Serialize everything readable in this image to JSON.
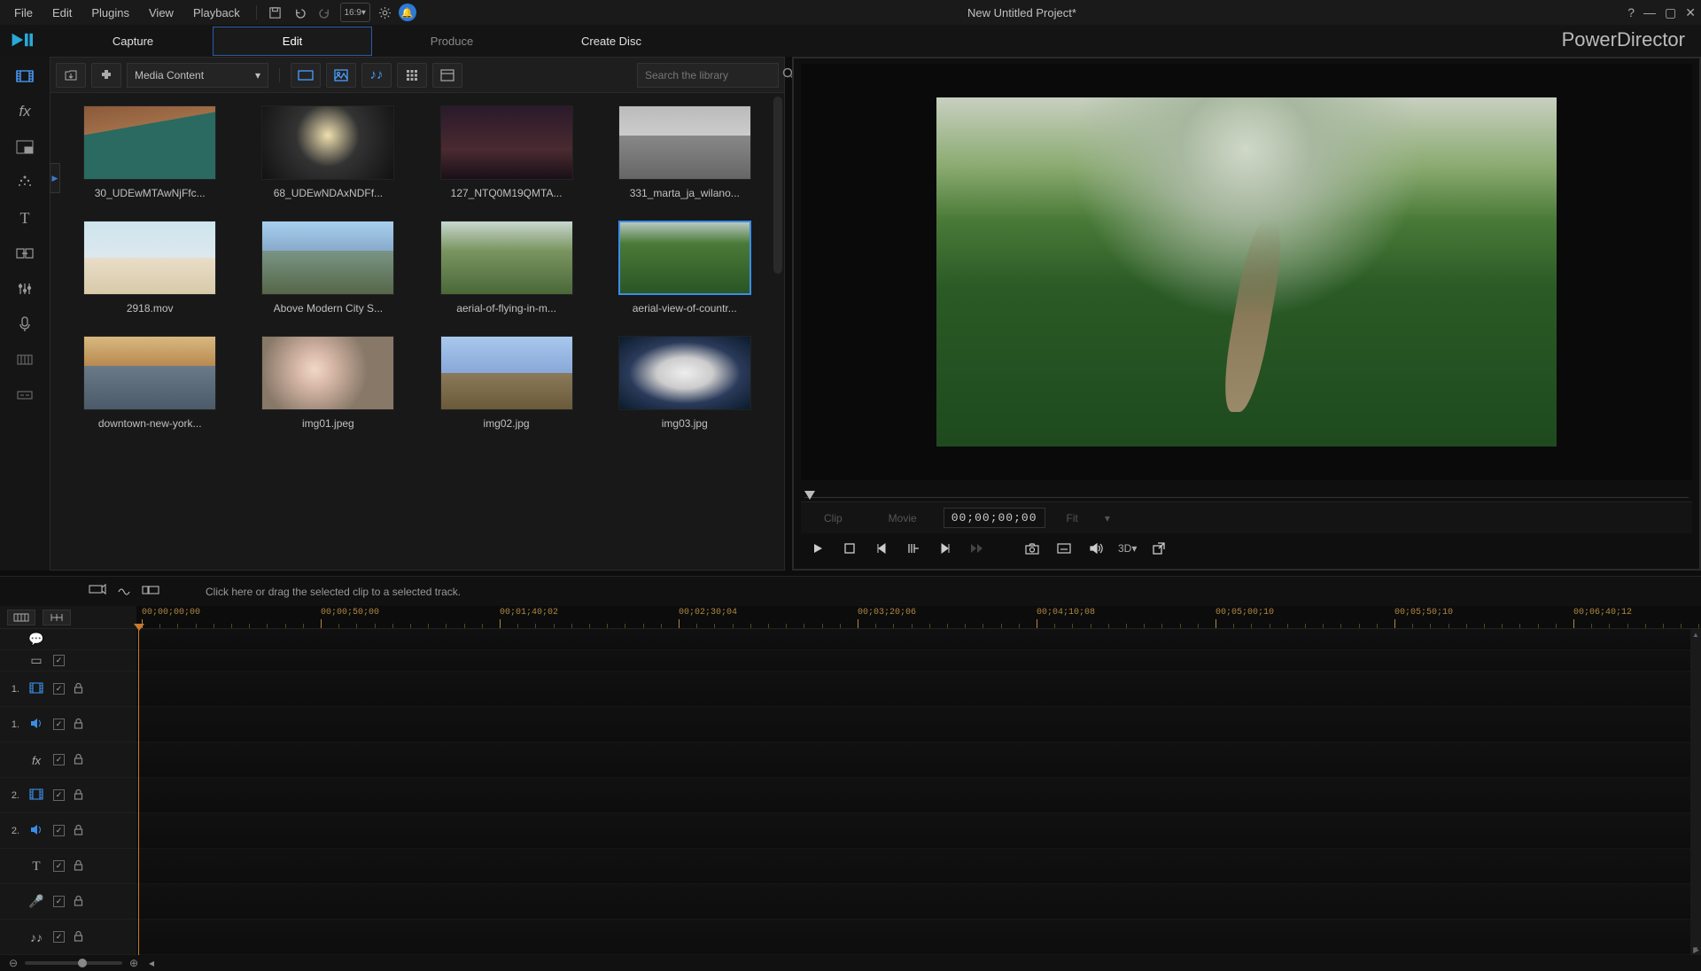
{
  "menu": {
    "items": [
      "File",
      "Edit",
      "Plugins",
      "View",
      "Playback"
    ]
  },
  "project_title": "New Untitled Project*",
  "brand": "PowerDirector",
  "tabs": [
    {
      "label": "Capture",
      "state": "white"
    },
    {
      "label": "Edit",
      "state": "active"
    },
    {
      "label": "Produce",
      "state": ""
    },
    {
      "label": "Create Disc",
      "state": "white"
    }
  ],
  "media": {
    "dropdown": "Media Content",
    "search_placeholder": "Search the library",
    "items": [
      {
        "name": "30_UDEwMTAwNjFfc...",
        "art": "th-a",
        "sel": false
      },
      {
        "name": "68_UDEwNDAxNDFf...",
        "art": "th-b",
        "sel": false
      },
      {
        "name": "127_NTQ0M19QMTA...",
        "art": "th-c",
        "sel": false
      },
      {
        "name": "331_marta_ja_wilano...",
        "art": "th-d",
        "sel": false
      },
      {
        "name": "2918.mov",
        "art": "th-e",
        "sel": false
      },
      {
        "name": "Above Modern City S...",
        "art": "th-f",
        "sel": false
      },
      {
        "name": "aerial-of-flying-in-m...",
        "art": "th-g",
        "sel": false
      },
      {
        "name": "aerial-view-of-countr...",
        "art": "th-h",
        "sel": true
      },
      {
        "name": "downtown-new-york...",
        "art": "th-i",
        "sel": false
      },
      {
        "name": "img01.jpeg",
        "art": "th-j",
        "sel": false
      },
      {
        "name": "img02.jpg",
        "art": "th-k",
        "sel": false
      },
      {
        "name": "img03.jpg",
        "art": "th-l",
        "sel": false
      }
    ]
  },
  "preview": {
    "tab_clip": "Clip",
    "tab_movie": "Movie",
    "timecode": "00;00;00;00",
    "fit": "Fit",
    "three_d": "3D"
  },
  "timeline": {
    "hint": "Click here or drag the selected clip to a selected track.",
    "ruler": [
      "00;00;00;00",
      "00;00;50;00",
      "00;01;40;02",
      "00;02;30;04",
      "00;03;20;06",
      "00;04;10;08",
      "00;05;00;10",
      "00;05;50;10",
      "00;06;40;12"
    ],
    "tracks": [
      {
        "num": "",
        "icon": "💬",
        "thin": true,
        "chk": false,
        "lock": false
      },
      {
        "num": "",
        "icon": "▭",
        "thin": true,
        "chk": true,
        "lock": false
      },
      {
        "num": "1.",
        "icon": "film",
        "accent": true,
        "chk": true,
        "lock": true
      },
      {
        "num": "1.",
        "icon": "spk",
        "accent": true,
        "chk": true,
        "lock": true
      },
      {
        "num": "",
        "icon": "fx",
        "chk": true,
        "lock": true
      },
      {
        "num": "2.",
        "icon": "film",
        "accent": true,
        "chk": true,
        "lock": true
      },
      {
        "num": "2.",
        "icon": "spk",
        "accent": true,
        "chk": true,
        "lock": true
      },
      {
        "num": "",
        "icon": "T",
        "chk": true,
        "lock": true
      },
      {
        "num": "",
        "icon": "🎤",
        "chk": true,
        "lock": true
      },
      {
        "num": "",
        "icon": "♪♪",
        "chk": true,
        "lock": true
      }
    ]
  }
}
